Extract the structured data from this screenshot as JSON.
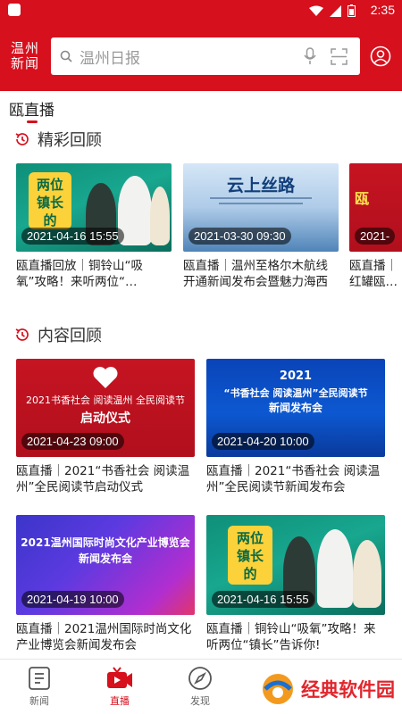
{
  "status_bar": {
    "time": "2:35"
  },
  "header": {
    "brand_line1": "温州",
    "brand_line2": "新闻",
    "search_placeholder": "温州日报"
  },
  "subtab": {
    "label": "瓯直播"
  },
  "sections": {
    "highlights": {
      "title": "精彩回顾",
      "items": [
        {
          "timestamp": "2021-04-16 15:55",
          "caption": "瓯直播回放｜铜铃山“吸氧”攻略！来听两位“…",
          "art_text": "两位 镇长 的"
        },
        {
          "timestamp": "2021-03-30 09:30",
          "caption": "瓯直播｜温州至格尔木航线开通新闻发布会暨魅力海西（…",
          "art_text": "云上丝路"
        },
        {
          "timestamp": "2021-",
          "caption": "瓯直播｜红罐瓯…",
          "art_text": "瓯"
        }
      ]
    },
    "content": {
      "title": "内容回顾",
      "items": [
        {
          "timestamp": "2021-04-23 09:00",
          "caption": "瓯直播｜2021“书香社会 阅读温州”全民阅读节启动仪式",
          "art_line1": "2021书香社会 阅读温州",
          "art_line2": "全民阅读节",
          "art_line3": "启动仪式"
        },
        {
          "timestamp": "2021-04-20 10:00",
          "caption": "瓯直播｜2021“书香社会 阅读温州”全民阅读节新闻发布会",
          "art_line1": "2021",
          "art_line2": "“书香社会 阅读温州”全民阅读节",
          "art_line3": "新闻发布会"
        },
        {
          "timestamp": "2021-04-19 10:00",
          "caption": "瓯直播｜2021温州国际时尚文化产业博览会新闻发布会",
          "art_line1": "2021温州国际时尚文化产业博览会",
          "art_line2": "新闻发布会"
        },
        {
          "timestamp": "2021-04-16 15:55",
          "caption": "瓯直播｜铜铃山“吸氧”攻略！来听两位“镇长”告诉你!",
          "art_text": "两位 镇长 的"
        }
      ]
    }
  },
  "bottom_nav": {
    "items": [
      {
        "label": "新闻"
      },
      {
        "label": "直播"
      },
      {
        "label": "发现"
      }
    ],
    "watermark": "经典软件园"
  },
  "colors": {
    "brand_red": "#d6101d",
    "nav_active": "#d6101d"
  }
}
